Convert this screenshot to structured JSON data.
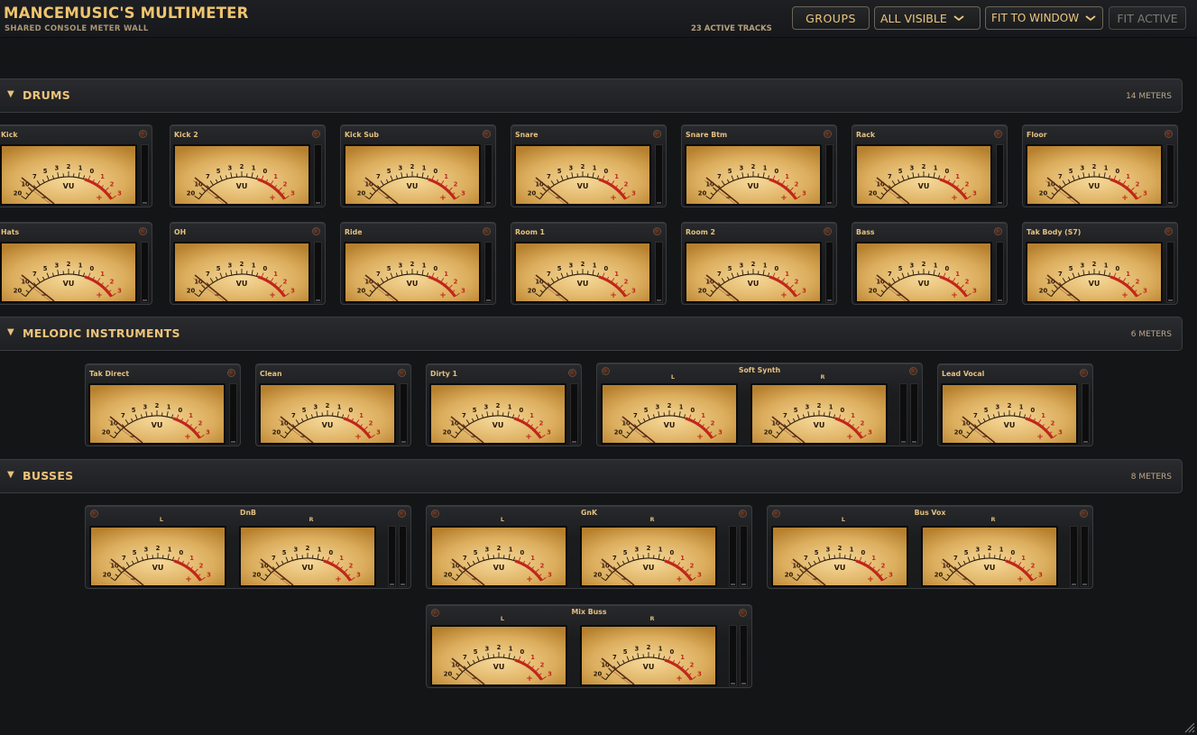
{
  "app": {
    "title": "MANCEMUSIC'S MULTIMETER",
    "subtitle": "SHARED CONSOLE METER WALL",
    "active_tracks": "23 ACTIVE TRACKS"
  },
  "toolbar": {
    "groups_label": "GROUPS",
    "visibility_value": "ALL VISIBLE",
    "fit_value": "FIT TO WINDOW",
    "fit_active_label": "FIT ACTIVE"
  },
  "meter_face": {
    "scale_labels": [
      "20",
      "10",
      "7",
      "5",
      "3",
      "2",
      "1",
      "0",
      "1",
      "2",
      "3"
    ],
    "unit": "VU",
    "minus": "−",
    "plus": "+"
  },
  "groups": [
    {
      "name": "DRUMS",
      "count": "14 METERS",
      "meters": [
        {
          "name": "Kick"
        },
        {
          "name": "Kick 2"
        },
        {
          "name": "Kick Sub"
        },
        {
          "name": "Snare"
        },
        {
          "name": "Snare Btm"
        },
        {
          "name": "Rack"
        },
        {
          "name": "Floor"
        },
        {
          "name": "Hats"
        },
        {
          "name": "OH"
        },
        {
          "name": "Ride"
        },
        {
          "name": "Room 1"
        },
        {
          "name": "Room 2"
        },
        {
          "name": "Bass"
        },
        {
          "name": "Tak Body (S7)"
        }
      ]
    },
    {
      "name": "MELODIC INSTRUMENTS",
      "count": "6 METERS",
      "meters": [
        {
          "name": "Tak Direct"
        },
        {
          "name": "Clean"
        },
        {
          "name": "Dirty 1"
        },
        {
          "name": "Soft Synth",
          "stereo": true,
          "channels": [
            "L",
            "R"
          ]
        },
        {
          "name": "Lead Vocal"
        }
      ]
    },
    {
      "name": "BUSSES",
      "count": "8 METERS",
      "meters": [
        {
          "name": "DnB",
          "stereo": true,
          "channels": [
            "L",
            "R"
          ]
        },
        {
          "name": "GnK",
          "stereo": true,
          "channels": [
            "L",
            "R"
          ]
        },
        {
          "name": "Bus Vox",
          "stereo": true,
          "channels": [
            "L",
            "R"
          ]
        },
        {
          "name": "Mix Buss",
          "stereo": true,
          "channels": [
            "L",
            "R"
          ]
        }
      ]
    }
  ],
  "colors": {
    "accent": "#f0c46e",
    "face_light": "#f6d99a",
    "face_dark": "#b6802e",
    "redline": "#c0261b",
    "needle": "#5a2a14"
  },
  "icons": {
    "group_toggle": "triangle-down-icon",
    "dropdown": "chevron-down-icon",
    "led": "peak-led-icon",
    "resize": "resize-grip-icon"
  }
}
